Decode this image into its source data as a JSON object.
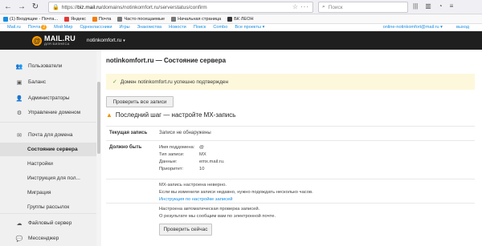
{
  "browser": {
    "url_prefix": "https://",
    "url_domain": "biz.mail.ru",
    "url_path": "/domains/notinkomfort.ru/serverstatus/confirm",
    "more": "···",
    "search_placeholder": "Поиск",
    "bookmarks": [
      {
        "label": "(1) Входящие - Почта...",
        "color": "#168de2"
      },
      {
        "label": "Яндекс",
        "color": "#e53935"
      },
      {
        "label": "Почта",
        "color": "#f57c00"
      },
      {
        "label": "Часто посещаемые",
        "color": "#777777"
      },
      {
        "label": "Начальная страница",
        "color": "#777777"
      },
      {
        "label": "БК ЛЕОН",
        "color": "#333333"
      }
    ]
  },
  "portal": {
    "links": [
      "Mail.ru",
      "Почта",
      "Мой Мир",
      "Одноклассники",
      "Игры",
      "Знакомства",
      "Новости",
      "Поиск",
      "Combo",
      "Все проекты ▾"
    ],
    "mail_badge": "2",
    "user": "online-notinkomfort@mail.ru ▾",
    "exit": "выход"
  },
  "header": {
    "brand": "MAIL.RU",
    "brand_sub": "ДЛЯ БИЗНЕСА",
    "domain": "notinkomfort.ru",
    "caret": "▾"
  },
  "sidebar": {
    "items": [
      {
        "label": "Пользователи",
        "icon": "users-icon",
        "glyph": "👥"
      },
      {
        "label": "Баланс",
        "icon": "wallet-icon",
        "glyph": "▣"
      },
      {
        "label": "Администраторы",
        "icon": "admin-icon",
        "glyph": "👤"
      },
      {
        "label": "Управление доменом",
        "icon": "gear-icon",
        "glyph": "⚙"
      },
      {
        "label": "Почта для домена",
        "icon": "mail-icon",
        "glyph": "✉"
      },
      {
        "label": "Состояние сервера",
        "sub": true,
        "active": true
      },
      {
        "label": "Настройки",
        "sub": true
      },
      {
        "label": "Инструкция для пол...",
        "sub": true
      },
      {
        "label": "Миграция",
        "sub": true
      },
      {
        "label": "Группы рассылок",
        "sub": true
      },
      {
        "label": "Файловый сервер",
        "icon": "cloud-icon",
        "glyph": "☁"
      },
      {
        "label": "Мессенджер",
        "icon": "chat-icon",
        "glyph": "💬"
      }
    ]
  },
  "main": {
    "title": "notinkomfort.ru — Состояние сервера",
    "notice": "Домен notinkomfort.ru успешно подтвержден",
    "check_all_button": "Проверить все записи",
    "step_title": "Последний шаг — настройте MX-запись",
    "current_label": "Текущая запись",
    "current_value": "Записи не обнаружены",
    "should_label": "Должно быть",
    "should": [
      {
        "k": "Имя поддомена:",
        "v": "@"
      },
      {
        "k": "Тип записи:",
        "v": "MX"
      },
      {
        "k": "Данные:",
        "v": "emx.mail.ru."
      },
      {
        "k": "Приоритет:",
        "v": "10"
      }
    ],
    "mx_bad": "MX-запись настроена неверно.",
    "mx_hint": "Если вы изменили записи недавно, нужно подождать несколько часов.",
    "mx_link": "Инструкция по настройке записей",
    "auto1": "Настроена автоматическая проверка записей.",
    "auto2": "О результате мы сообщим вам по электронной почте.",
    "check_now_button": "Проверить сейчас"
  }
}
